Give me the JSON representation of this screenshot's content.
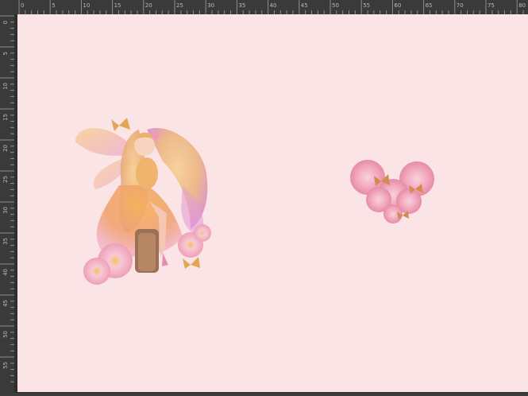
{
  "ruler": {
    "top_labels": [
      "0",
      "5",
      "10",
      "15",
      "20",
      "25",
      "30",
      "35",
      "40",
      "45",
      "50",
      "55",
      "60",
      "65",
      "70",
      "75",
      "80"
    ],
    "left_labels": [
      "0",
      "5",
      "10",
      "15",
      "20",
      "25",
      "30",
      "35",
      "40",
      "45",
      "50",
      "55"
    ]
  },
  "canvas": {
    "background": "#fbe4e6"
  },
  "artworks": [
    {
      "name": "fairy-illustration",
      "colors": [
        "#f5b47a",
        "#e88fb7",
        "#f2c98a"
      ]
    },
    {
      "name": "flower-heart-illustration",
      "colors": [
        "#f4a6bd",
        "#f7c9d6",
        "#d38c4f"
      ]
    }
  ]
}
